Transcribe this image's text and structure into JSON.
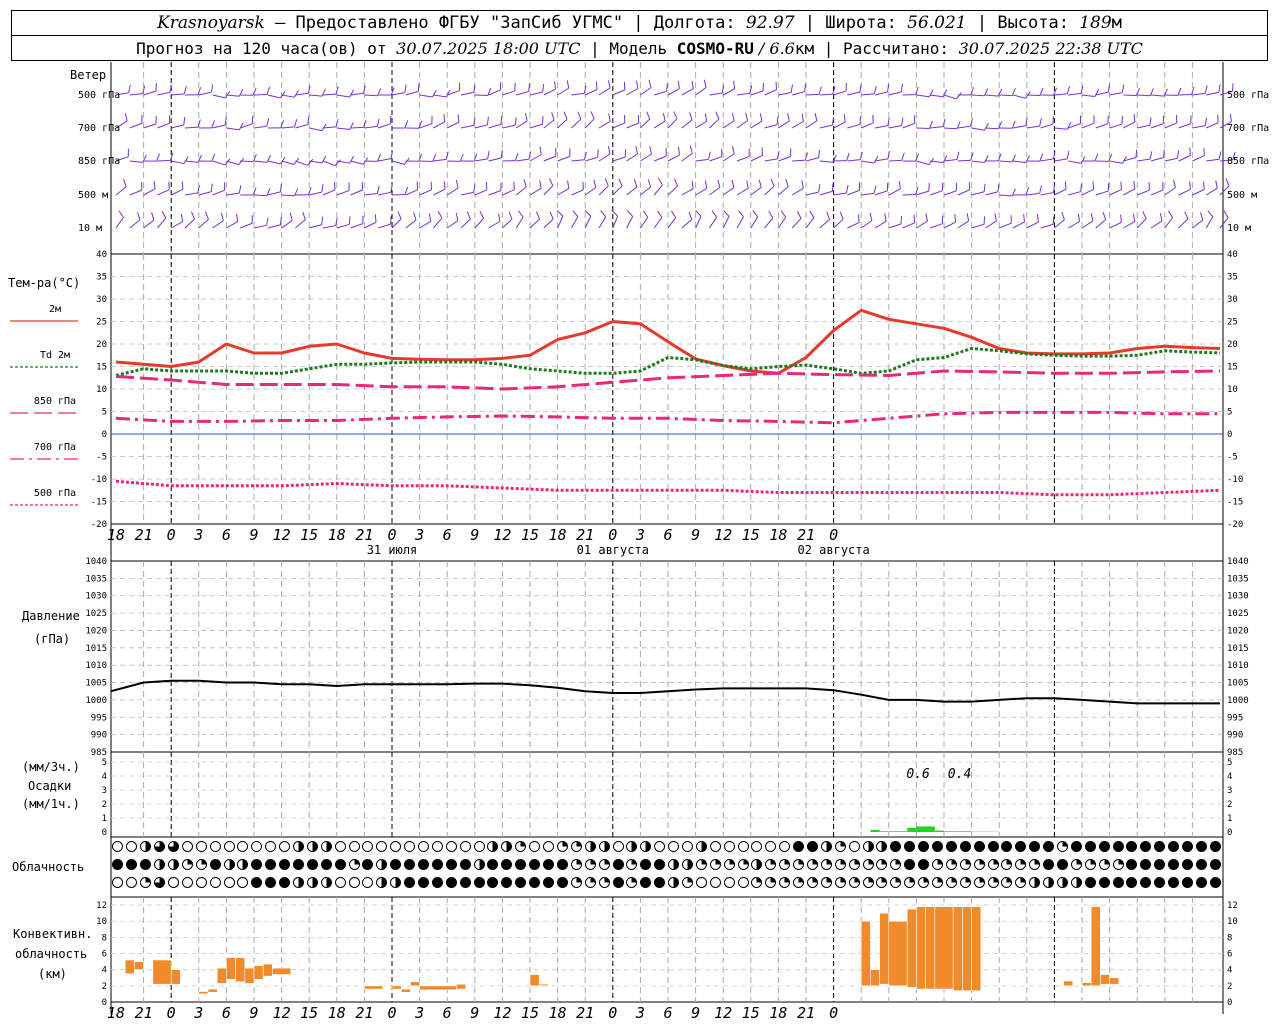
{
  "header": {
    "city": "Krasnoyarsk",
    "provider": " — Предоставлено ФГБУ \"ЗапСиб УГМС\" | Долгота: ",
    "lon": "92.97",
    "lat_label": " | Широта: ",
    "lat": "56.021",
    "alt_label": " | Высота: ",
    "alt": "189",
    "alt_unit": "м",
    "forecast_prefix": "Прогноз на 120 часа(ов) от ",
    "forecast_from": "30.07.2025 18:00 UTC",
    "model_label": "  | Модель ",
    "model": "COSMO-RU",
    "model_res": " / 6.6",
    "model_res_unit": "км",
    "calc_label": " | Рассчитано: ",
    "calc_time": "30.07.2025 22:38 UTC"
  },
  "wind_panel": {
    "title": "Ветер",
    "levels": [
      "500 гПа",
      "700 гПа",
      "850 гПа",
      "500 м",
      "10  м"
    ],
    "color": "#7a2fd0"
  },
  "temp_panel": {
    "title": "Тем-ра(°С)",
    "legend": [
      "2м",
      "Td  2м",
      "850 гПа",
      "700 гПа",
      "500 гПа"
    ]
  },
  "pressure_panel": {
    "title": "Давление",
    "unit": "(гПа)"
  },
  "precip_panel": {
    "unit3h": "(мм/3ч.)",
    "title": "Осадки",
    "unit1h": "(мм/1ч.)",
    "annotations": [
      "0.6",
      "0.4"
    ]
  },
  "cloud_panel": {
    "title": "Облачность"
  },
  "conv_panel": {
    "title": [
      "Конвективн.",
      "облачность",
      "(км)"
    ]
  },
  "time_axis": {
    "hour_labels": [
      "18",
      "21",
      "0",
      "3",
      "6",
      "9",
      "12",
      "15",
      "18",
      "21",
      "0",
      "3",
      "6",
      "9",
      "12",
      "15",
      "18",
      "21",
      "0",
      "3",
      "6",
      "9",
      "12",
      "15",
      "18",
      "21",
      "0"
    ],
    "dates": [
      "31 июля",
      "01 августа",
      "02 августа"
    ]
  },
  "chart_data": [
    {
      "type": "line",
      "title": "Тем-ра(°С)",
      "x_unit": "hours from 30.07.2025 18:00 UTC",
      "ylim": [
        -20,
        40
      ],
      "yticks": [
        -20,
        -15,
        -10,
        -5,
        0,
        5,
        10,
        15,
        20,
        25,
        30,
        35,
        40
      ],
      "grid": true,
      "series": [
        {
          "name": "2м",
          "color": "#e8392c",
          "style": "solid",
          "x": [
            0,
            3,
            6,
            9,
            12,
            15,
            18,
            21,
            24,
            27,
            30,
            33,
            36,
            39,
            42,
            45,
            48,
            51,
            54,
            57,
            60,
            63,
            66,
            69,
            72,
            75,
            78,
            81,
            84,
            87,
            90,
            93,
            96,
            99,
            102,
            105,
            108,
            111,
            114,
            117,
            120
          ],
          "y": [
            16,
            15.5,
            15,
            16,
            20,
            18,
            18,
            19.5,
            20,
            18,
            16.8,
            16.6,
            16.5,
            16.5,
            16.8,
            17.5,
            21,
            22.5,
            25,
            24.5,
            20.5,
            16.7,
            15.2,
            14,
            13.5,
            17,
            23,
            27.5,
            25.5,
            24.5,
            23.5,
            21.5,
            19,
            18,
            17.8,
            17.8,
            18,
            19,
            19.5,
            19.2,
            19
          ]
        },
        {
          "name": "Td  2м",
          "color": "#1d7a1d",
          "style": "dotted",
          "x": [
            0,
            3,
            6,
            9,
            12,
            15,
            18,
            21,
            24,
            27,
            30,
            33,
            36,
            39,
            42,
            45,
            48,
            51,
            54,
            57,
            60,
            63,
            66,
            69,
            72,
            75,
            78,
            81,
            84,
            87,
            90,
            93,
            96,
            99,
            102,
            105,
            108,
            111,
            114,
            117,
            120
          ],
          "y": [
            13,
            14.5,
            14,
            14,
            14,
            13.5,
            13.5,
            14.5,
            15.5,
            15.5,
            15.8,
            16,
            16,
            16,
            15.5,
            14.5,
            14,
            13.5,
            13.5,
            14,
            17,
            16.5,
            15.2,
            14.5,
            15,
            15.3,
            14.5,
            13.5,
            14,
            16.5,
            17,
            19,
            18.5,
            17.8,
            17.5,
            17.3,
            17.3,
            17.5,
            18.5,
            18.2,
            18
          ]
        },
        {
          "name": "850 гПа",
          "color": "#e8287a",
          "style": "long-dash",
          "x": [
            0,
            6,
            12,
            18,
            24,
            30,
            36,
            42,
            48,
            54,
            60,
            66,
            72,
            78,
            84,
            90,
            96,
            102,
            108,
            114,
            120
          ],
          "y": [
            12.8,
            12,
            11,
            11,
            11,
            10.5,
            10.5,
            10,
            10.5,
            11.5,
            12.5,
            13,
            13.5,
            13.2,
            13,
            14,
            13.8,
            13.5,
            13.5,
            13.8,
            14
          ]
        },
        {
          "name": "700 гПа",
          "color": "#e8287a",
          "style": "dash-dot",
          "x": [
            0,
            6,
            12,
            18,
            24,
            30,
            36,
            42,
            48,
            54,
            60,
            66,
            72,
            78,
            84,
            90,
            96,
            102,
            108,
            114,
            120
          ],
          "y": [
            3.5,
            2.8,
            2.8,
            3,
            3,
            3.5,
            3.8,
            4,
            3.8,
            3.5,
            3.5,
            3,
            2.8,
            2.5,
            3.5,
            4.5,
            4.8,
            4.8,
            4.8,
            4.5,
            4.5
          ]
        },
        {
          "name": "500 гПа",
          "color": "#e8287a",
          "style": "dotted",
          "x": [
            0,
            6,
            12,
            18,
            24,
            30,
            36,
            42,
            48,
            54,
            60,
            66,
            72,
            78,
            84,
            90,
            96,
            102,
            108,
            114,
            120
          ],
          "y": [
            -10.5,
            -11.5,
            -11.5,
            -11.5,
            -11,
            -11.5,
            -11.5,
            -12,
            -12.5,
            -12.5,
            -12.5,
            -12.5,
            -13,
            -13,
            -13,
            -13,
            -13,
            -13.5,
            -13.5,
            -13,
            -12.5
          ]
        }
      ]
    },
    {
      "type": "line",
      "title": "Давление",
      "ylabel": "(гПа)",
      "ylim": [
        985,
        1040
      ],
      "yticks": [
        985,
        990,
        995,
        1000,
        1005,
        1010,
        1015,
        1020,
        1025,
        1030,
        1035,
        1040
      ],
      "grid": true,
      "series": [
        {
          "color": "#000000",
          "x": [
            0,
            3,
            6,
            9,
            12,
            15,
            18,
            21,
            24,
            27,
            30,
            33,
            36,
            39,
            42,
            45,
            48,
            51,
            54,
            57,
            60,
            63,
            66,
            69,
            72,
            75,
            78,
            81,
            84,
            87,
            90,
            93,
            96,
            99,
            102,
            105,
            108,
            111,
            114,
            117,
            120
          ],
          "y": [
            1002.5,
            1005,
            1005.5,
            1005.5,
            1005,
            1005,
            1004.5,
            1004.5,
            1004,
            1004.5,
            1004.5,
            1004.5,
            1004.5,
            1004.7,
            1004.7,
            1004.2,
            1003.5,
            1002.5,
            1002,
            1002,
            1002.5,
            1003,
            1003.3,
            1003.3,
            1003.3,
            1003.3,
            1002.8,
            1001.5,
            1000,
            1000,
            999.5,
            999.5,
            1000,
            1000.5,
            1000.5,
            1000,
            999.5,
            999,
            999,
            999,
            999
          ]
        }
      ]
    },
    {
      "type": "bar",
      "title": "Осадки",
      "ylabel": "(мм/1ч.)",
      "ylim": [
        0,
        5
      ],
      "yticks": [
        0,
        1,
        2,
        3,
        4,
        5
      ],
      "series": [
        {
          "color": "#22d422",
          "x": [
            82,
            83,
            84,
            85,
            86,
            87,
            88,
            89,
            90,
            91,
            92,
            93,
            94,
            95
          ],
          "y": [
            0.15,
            0.05,
            0.05,
            0.05,
            0.3,
            0.4,
            0.4,
            0.1,
            0.05,
            0.05,
            0.05,
            0.02,
            0.02,
            0.02
          ]
        }
      ],
      "annotations": [
        {
          "x": 87,
          "text": "0.6"
        },
        {
          "x": 91.5,
          "text": "0.4"
        }
      ]
    },
    {
      "type": "bar",
      "title": "Конвективн. облачность (км)",
      "ylim": [
        0,
        13
      ],
      "yticks": [
        0,
        2,
        4,
        6,
        8,
        10,
        12
      ],
      "series": [
        {
          "name": "convective cloud layer",
          "color": "#f08a2a",
          "bars": [
            {
              "x0": 1,
              "x1": 2,
              "bottom": 3.5,
              "top": 5.2
            },
            {
              "x0": 2,
              "x1": 3,
              "bottom": 4.0,
              "top": 5.0
            },
            {
              "x0": 4,
              "x1": 6,
              "bottom": 2.2,
              "top": 5.2
            },
            {
              "x0": 6,
              "x1": 7,
              "bottom": 2.2,
              "top": 4.0
            },
            {
              "x0": 9,
              "x1": 10,
              "bottom": 1.0,
              "top": 1.3
            },
            {
              "x0": 10,
              "x1": 11,
              "bottom": 1.2,
              "top": 1.6
            },
            {
              "x0": 11,
              "x1": 12,
              "bottom": 2.3,
              "top": 4.2
            },
            {
              "x0": 12,
              "x1": 13,
              "bottom": 2.8,
              "top": 5.5
            },
            {
              "x0": 13,
              "x1": 14,
              "bottom": 2.5,
              "top": 5.5
            },
            {
              "x0": 14,
              "x1": 15,
              "bottom": 2.3,
              "top": 4.2
            },
            {
              "x0": 15,
              "x1": 16,
              "bottom": 2.8,
              "top": 4.5
            },
            {
              "x0": 16,
              "x1": 17,
              "bottom": 3.2,
              "top": 4.7
            },
            {
              "x0": 17,
              "x1": 19,
              "bottom": 3.4,
              "top": 4.2
            },
            {
              "x0": 27,
              "x1": 29,
              "bottom": 1.6,
              "top": 2.0
            },
            {
              "x0": 30,
              "x1": 31,
              "bottom": 1.6,
              "top": 2.0
            },
            {
              "x0": 31,
              "x1": 32,
              "bottom": 1.2,
              "top": 1.6
            },
            {
              "x0": 32,
              "x1": 33,
              "bottom": 2.0,
              "top": 2.5
            },
            {
              "x0": 33,
              "x1": 37,
              "bottom": 1.5,
              "top": 2.0
            },
            {
              "x0": 37,
              "x1": 38,
              "bottom": 1.6,
              "top": 2.2
            },
            {
              "x0": 45,
              "x1": 46,
              "bottom": 2.0,
              "top": 3.4
            },
            {
              "x0": 46,
              "x1": 47,
              "bottom": 2.0,
              "top": 2.2
            },
            {
              "x0": 81,
              "x1": 82,
              "bottom": 2.0,
              "top": 10.0
            },
            {
              "x0": 82,
              "x1": 83,
              "bottom": 2.0,
              "top": 4.0
            },
            {
              "x0": 83,
              "x1": 84,
              "bottom": 2.2,
              "top": 11.0
            },
            {
              "x0": 84,
              "x1": 86,
              "bottom": 2.0,
              "top": 10.0
            },
            {
              "x0": 86,
              "x1": 87,
              "bottom": 1.8,
              "top": 11.5
            },
            {
              "x0": 87,
              "x1": 88,
              "bottom": 1.6,
              "top": 11.8
            },
            {
              "x0": 88,
              "x1": 89,
              "bottom": 1.6,
              "top": 11.8
            },
            {
              "x0": 89,
              "x1": 91,
              "bottom": 1.6,
              "top": 11.8
            },
            {
              "x0": 91,
              "x1": 92,
              "bottom": 1.4,
              "top": 11.8
            },
            {
              "x0": 92,
              "x1": 93,
              "bottom": 1.4,
              "top": 11.8
            },
            {
              "x0": 93,
              "x1": 94,
              "bottom": 1.4,
              "top": 11.8
            },
            {
              "x0": 103,
              "x1": 104,
              "bottom": 2.0,
              "top": 2.6
            },
            {
              "x0": 105,
              "x1": 106,
              "bottom": 2.0,
              "top": 2.4
            },
            {
              "x0": 106,
              "x1": 107,
              "bottom": 2.0,
              "top": 11.8
            },
            {
              "x0": 107,
              "x1": 108,
              "bottom": 2.2,
              "top": 3.4
            },
            {
              "x0": 108,
              "x1": 109,
              "bottom": 2.2,
              "top": 3.0
            }
          ]
        }
      ]
    }
  ],
  "cloud_rows": [
    "OOHTTOOOOOOOOHHHOOOOOOOOOOOHHQOOQQHHOHHOOOHOOOOOOFFHQOHHFFFFFFFFFFFFQFFFFFFFFFFFFFFFHFOHHFFOHQQQFFQ",
    "FFFHHQQFHHFFFFFFFQFHFFFFFFHFFFFFFQQQFQFFHHQQQQHQQQQQQQQQQFFQQQQQQQQFFQQQQFFFFFFFFFFFFFQFFOHFFQQQQQHF",
    "OOQTOOOOOOFFFHHHOOOHHFFFFFFFFFFFFQQQFQFFHQOOOOQQQQQQQQQQQQQQQQQQQQHHHHFFFFFFFFFFFFFFFQFFFFFHQQQHHFF"
  ]
}
